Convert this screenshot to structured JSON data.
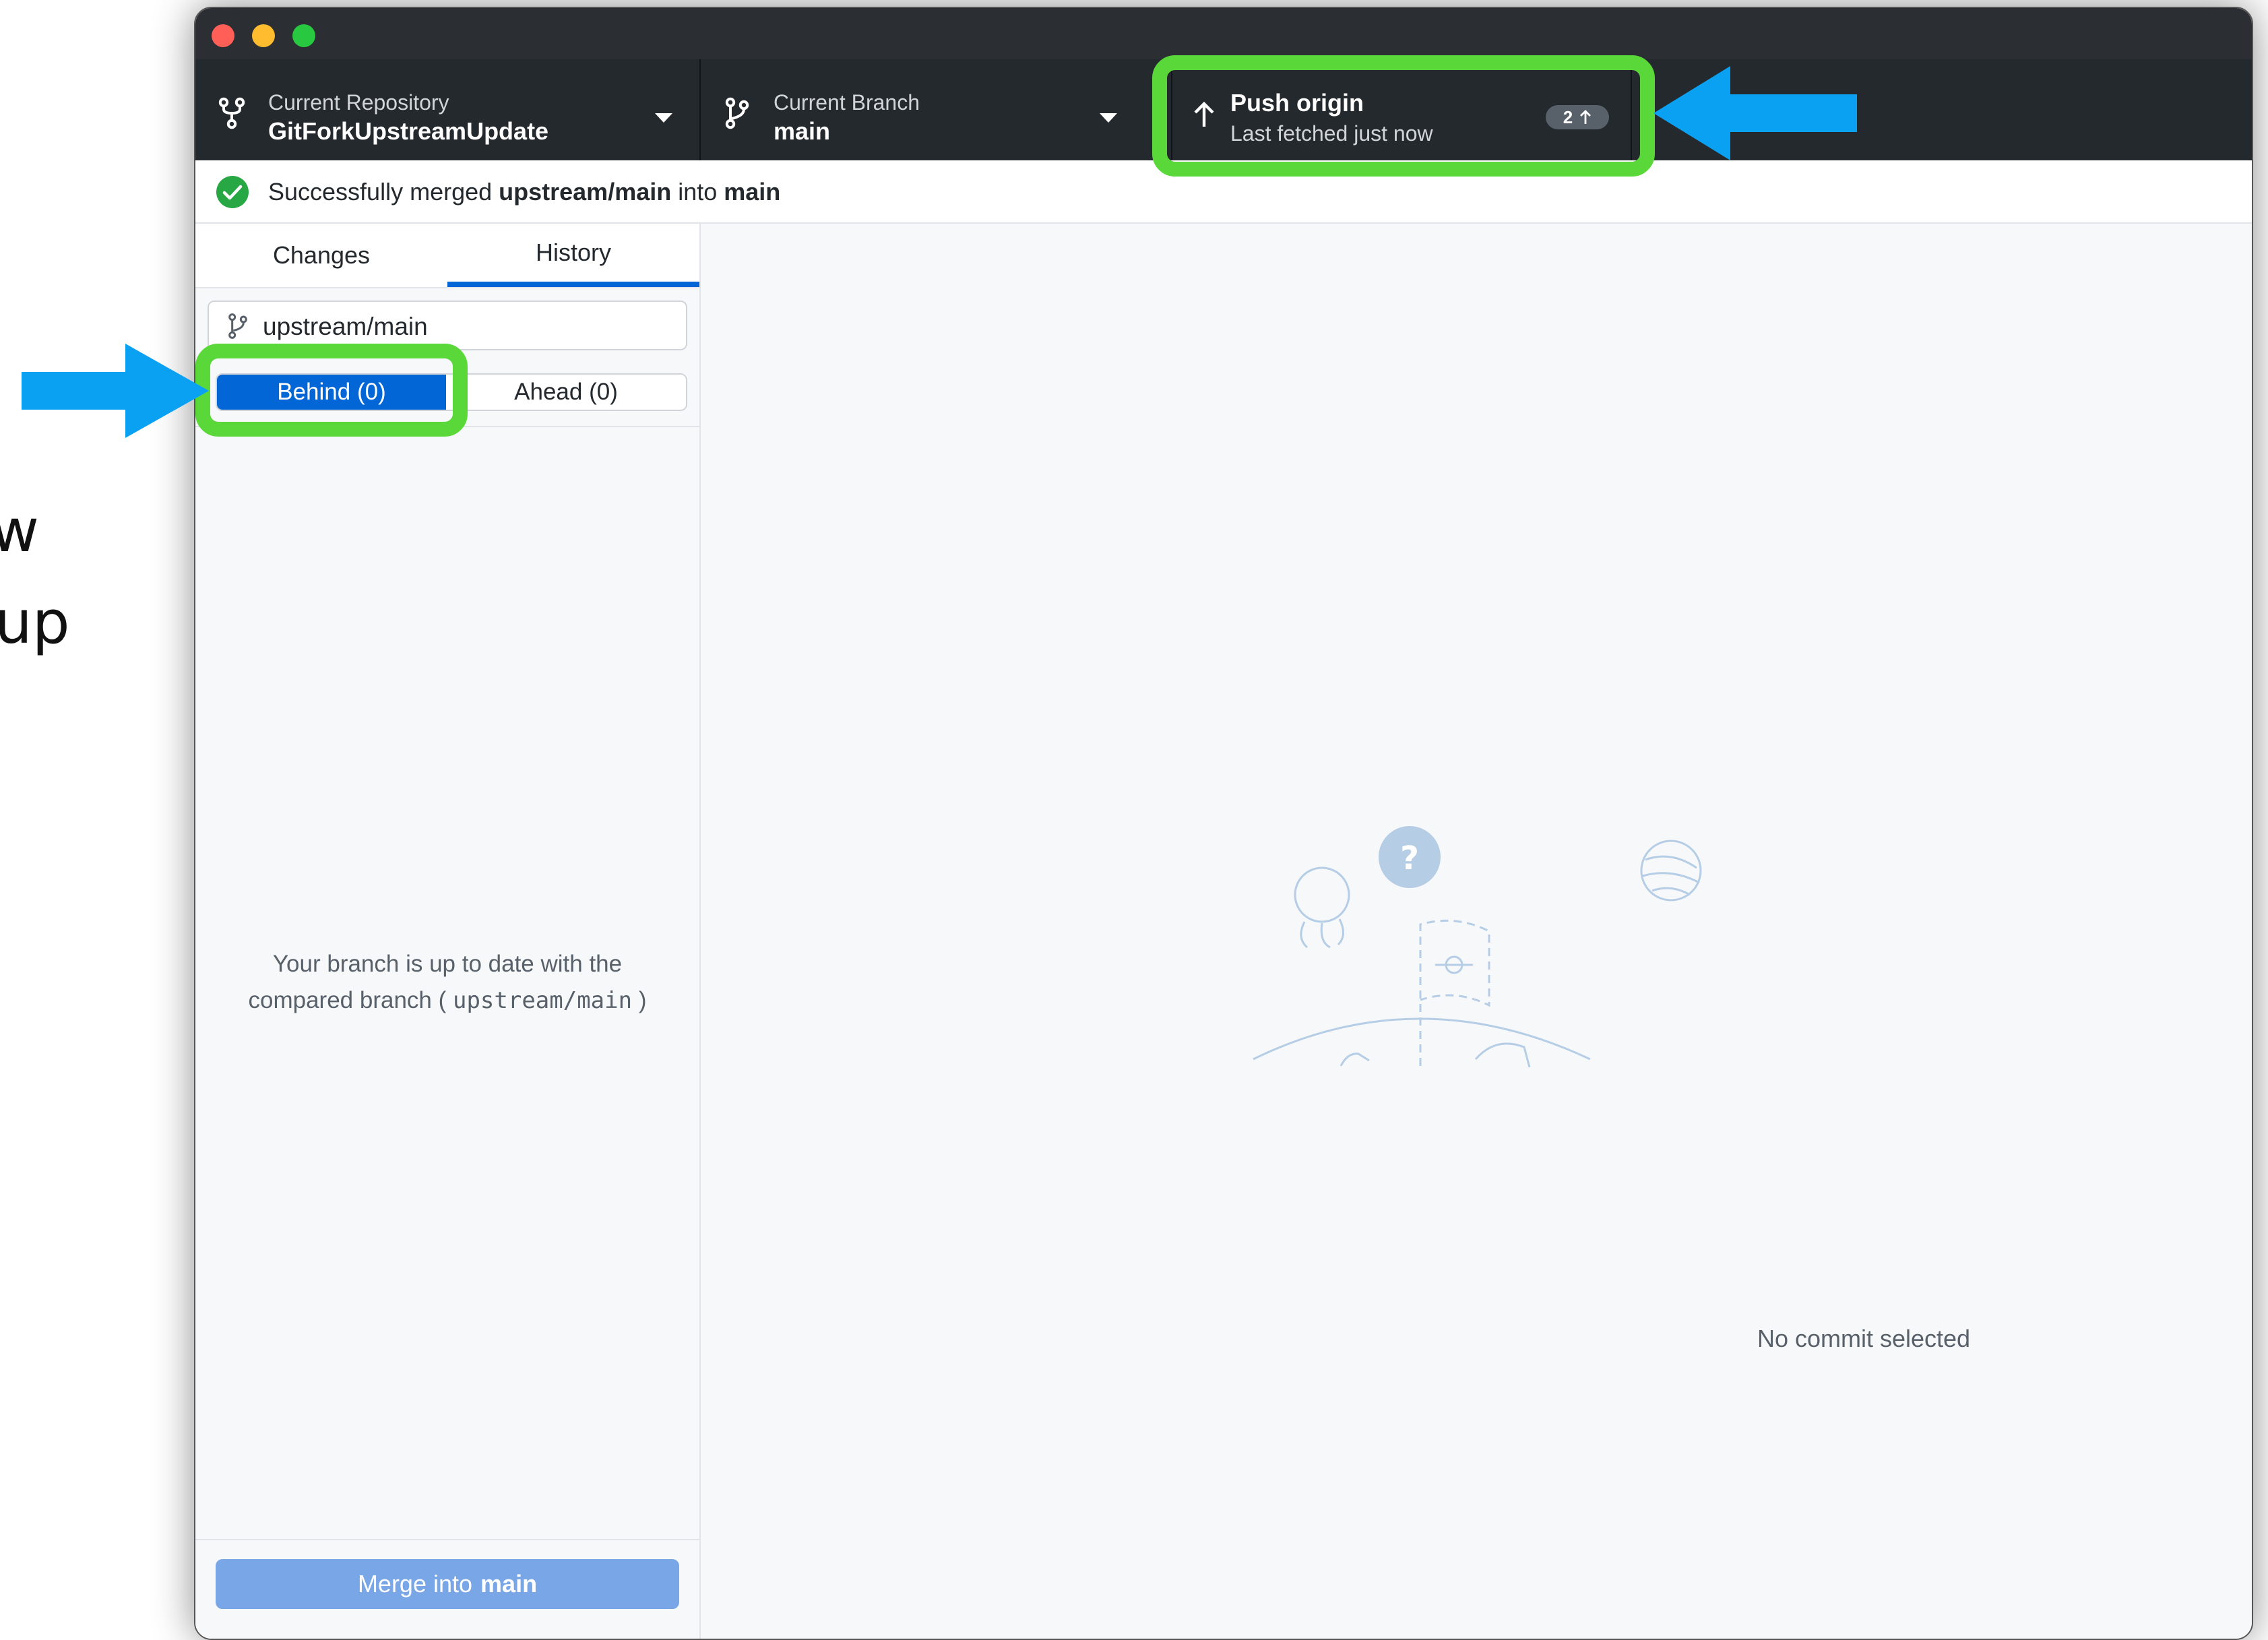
{
  "slide_fragments": [
    "w",
    "up"
  ],
  "toolbar": {
    "repo_label": "Current Repository",
    "repo_name": "GitForkUpstreamUpdate",
    "branch_label": "Current Branch",
    "branch_name": "main",
    "push_title": "Push origin",
    "push_subtitle": "Last fetched just now",
    "push_badge_count": "2"
  },
  "banner": {
    "prefix": "Successfully merged ",
    "source": "upstream/main",
    "middle": " into ",
    "target": "main"
  },
  "tabs": [
    "Changes",
    "History"
  ],
  "active_tab": "History",
  "compare": {
    "branch_value": "upstream/main",
    "behind_label": "Behind (0)",
    "ahead_label": "Ahead (0)",
    "message_line1": "Your branch is up to date with the",
    "message_line2_prefix": "compared branch ( ",
    "message_branch": "upstream/main",
    "message_line2_suffix": " )"
  },
  "merge_button": {
    "prefix": "Merge into",
    "branch": "main"
  },
  "main_panel": {
    "empty_message": "No commit selected"
  },
  "colors": {
    "highlight": "#5ad83a",
    "arrow": "#0aa1f2",
    "accent": "#0366d6",
    "toolbar": "#24292e"
  },
  "icons": [
    "repo-icon",
    "branch-icon",
    "caret-down-icon",
    "arrow-up-icon",
    "success-check-icon",
    "branch-filter-icon",
    "empty-state-illustration"
  ]
}
